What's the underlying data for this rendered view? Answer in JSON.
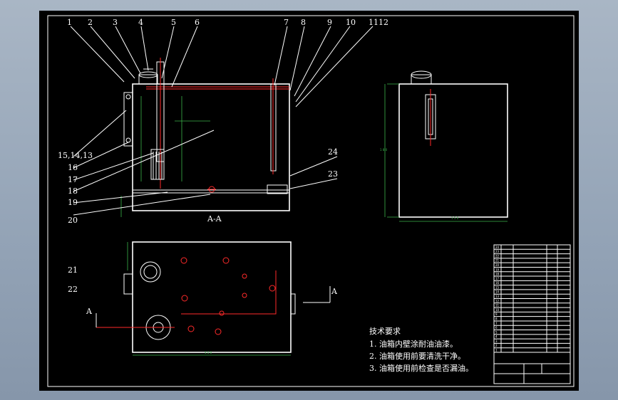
{
  "drawing": {
    "section_label": "A-A",
    "section_arrow_label": "A",
    "callouts": [
      "1",
      "2",
      "3",
      "4",
      "5",
      "6",
      "7",
      "8",
      "9",
      "10",
      "1112",
      "15,14,13",
      "16",
      "17",
      "18",
      "19",
      "20",
      "21",
      "22",
      "23",
      "24"
    ]
  },
  "tech_requirements": {
    "title": "技术要求",
    "items": [
      "1. 油箱内壁涂耐油油漆。",
      "2. 油箱使用前要清洗干净。",
      "3. 油箱使用前检查是否漏油。"
    ]
  },
  "title_block": {
    "rows": [
      "24",
      "23",
      "22",
      "21",
      "20",
      "19",
      "18",
      "17",
      "16",
      "15",
      "14",
      "13",
      "12",
      "11",
      "10",
      "9",
      "8",
      "7",
      "6",
      "5",
      "4",
      "3",
      "2",
      "1"
    ]
  },
  "colors": {
    "outline": "#ffffff",
    "centerline": "#ff2a2a",
    "dimension": "#3ab34a",
    "background": "#000000",
    "frame": "#9aa8b8"
  }
}
